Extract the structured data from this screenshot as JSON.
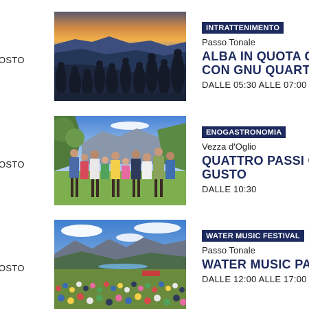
{
  "events": [
    {
      "left_label": "OSTO",
      "category": "INTRATTENIMENTO",
      "location": "Passo Tonale",
      "title_line1": "ALBA IN QUOTA C",
      "title_line2": "CON GNU QUART",
      "time": "DALLE 05:30 ALLE 07:00",
      "image_alt": "sunrise-mountain-photo"
    },
    {
      "left_label": "OSTO",
      "category": "ENOGASTRONOMIA",
      "location": "Vezza d'Oglio",
      "title_line1": "QUATTRO PASSI C",
      "title_line2": "GUSTO",
      "time": "DALLE 10:30",
      "image_alt": "hiking-group-photo"
    },
    {
      "left_label": "OSTO",
      "category": "WATER MUSIC FESTIVAL",
      "location": "Passo Tonale",
      "title_line1": "WATER MUSIC PA",
      "title_line2": "",
      "time": "DALLE 12:00 ALLE 17:00",
      "image_alt": "festival-crowd-photo"
    }
  ],
  "colors": {
    "badge_bg": "#1d2a5e",
    "title": "#1d2a5e"
  }
}
